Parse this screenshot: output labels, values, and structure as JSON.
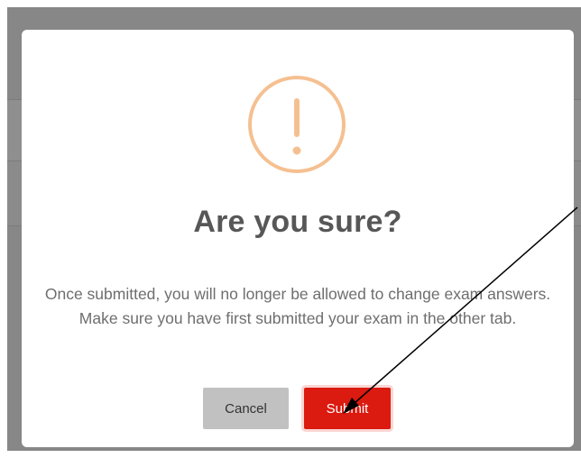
{
  "dialog": {
    "title": "Are you sure?",
    "message": "Once submitted, you will no longer be allowed to change exam answers. Make sure you have first submitted your exam in the other tab.",
    "cancel_label": "Cancel",
    "submit_label": "Submit",
    "icon": "warning-circle-icon"
  },
  "colors": {
    "icon": "#f5c091",
    "submit": "#db1a10",
    "cancel": "#c1c1c1",
    "title": "#575757",
    "message": "#6e6e6e",
    "backdrop": "#878787"
  }
}
